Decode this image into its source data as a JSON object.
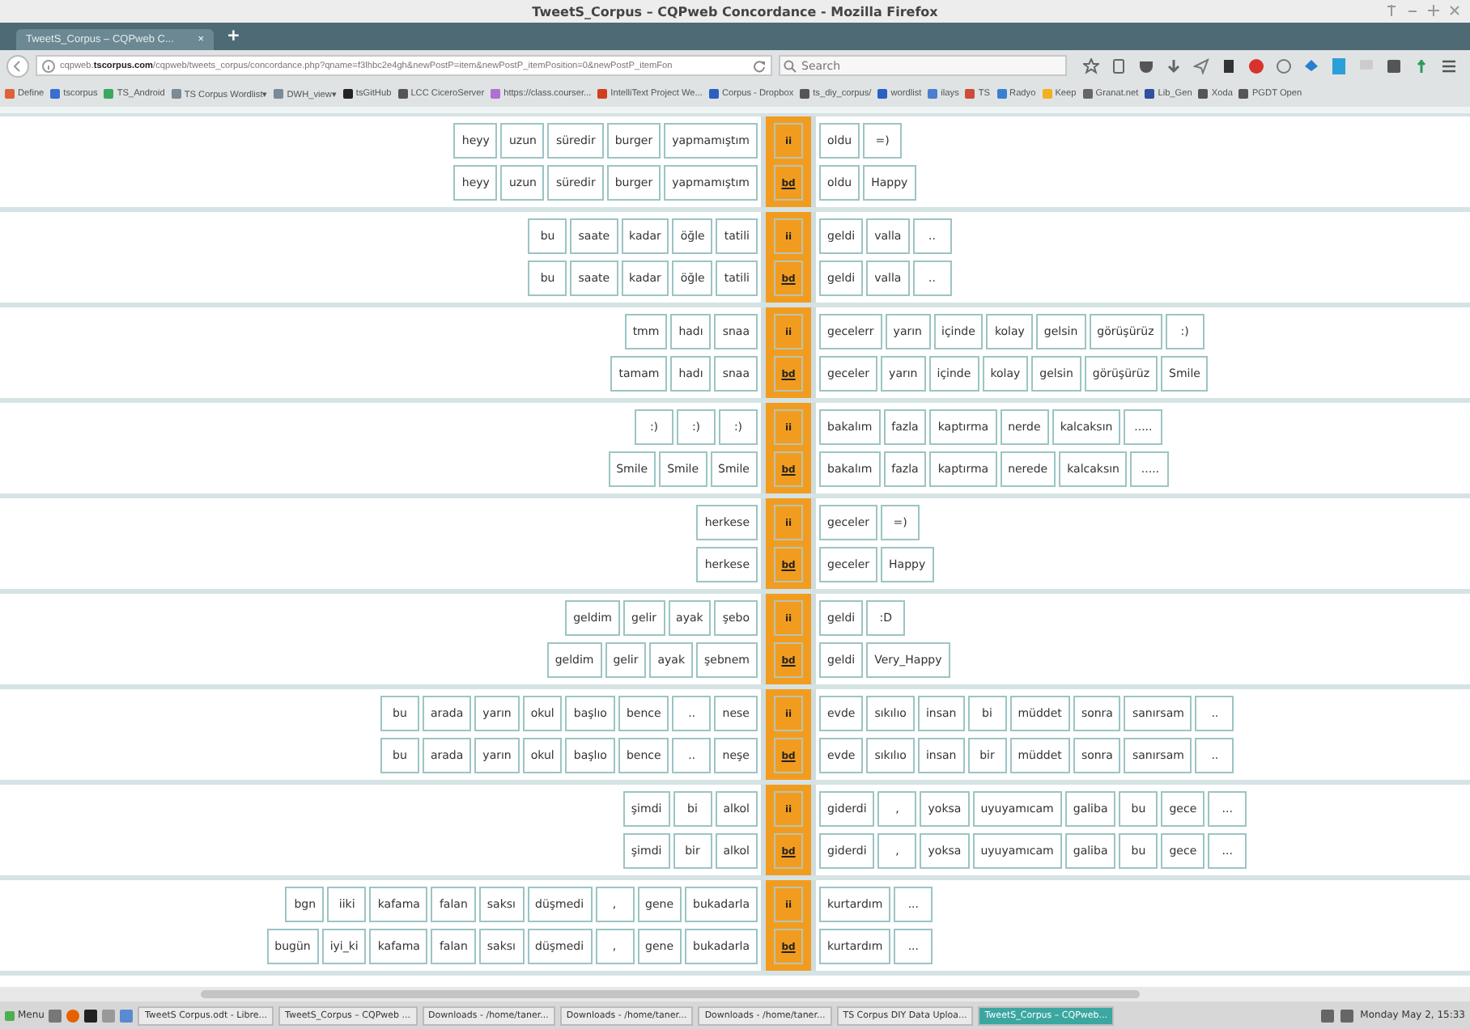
{
  "window": {
    "title": "TweetS_Corpus – CQPweb Concordance - Mozilla Firefox"
  },
  "tab": {
    "label": "TweetS_Corpus – CQPweb C...",
    "close": "×",
    "new_tab": "+"
  },
  "address": {
    "url": "cqpweb.**tscorpus.com**/cqpweb/tweets_corpus/concordance.php?qname=f3lhbc2e4gh&newPostP=item&newPostP_itemPosition=0&newPostP_itemFon",
    "search_placeholder": "Search"
  },
  "bookmarks": [
    "Define",
    "tscorpus",
    "TS_Android",
    "TS Corpus Wordlist▾",
    "DWH_view▾",
    "tsGitHub",
    "LCC CiceroServer",
    "https://class.courser...",
    "IntelliText Project We...",
    "Corpus - Dropbox",
    "ts_diy_corpus/",
    "wordlist",
    "ilays",
    "TS",
    "Radyo",
    "Keep",
    "Granat.net",
    "Lib_Gen",
    "Xoda",
    "PGDT Open"
  ],
  "concordance": [
    {
      "mark_top": "ii",
      "mark_bottom": "bd",
      "left_top": [
        "heyy",
        "uzun",
        "süredir",
        "burger",
        "yapmamıştım"
      ],
      "left_bottom": [
        "heyy",
        "uzun",
        "süredir",
        "burger",
        "yapmamıştım"
      ],
      "right_top": [
        "oldu",
        "=)"
      ],
      "right_bottom": [
        "oldu",
        "Happy"
      ]
    },
    {
      "mark_top": "ii",
      "mark_bottom": "bd",
      "left_top": [
        "bu",
        "saate",
        "kadar",
        "öğle",
        "tatili"
      ],
      "left_bottom": [
        "bu",
        "saate",
        "kadar",
        "öğle",
        "tatili"
      ],
      "right_top": [
        "geldi",
        "valla",
        ".."
      ],
      "right_bottom": [
        "geldi",
        "valla",
        ".."
      ]
    },
    {
      "mark_top": "ii",
      "mark_bottom": "bd",
      "left_top": [
        "tmm",
        "hadı",
        "snaa"
      ],
      "left_bottom": [
        "tamam",
        "hadı",
        "snaa"
      ],
      "right_top": [
        "gecelerr",
        "yarın",
        "içinde",
        "kolay",
        "gelsin",
        "görüşürüz",
        ":)"
      ],
      "right_bottom": [
        "geceler",
        "yarın",
        "içinde",
        "kolay",
        "gelsin",
        "görüşürüz",
        "Smile"
      ]
    },
    {
      "mark_top": "ii",
      "mark_bottom": "bd",
      "left_top": [
        ":)",
        ":)",
        ":)"
      ],
      "left_bottom": [
        "Smile",
        "Smile",
        "Smile"
      ],
      "right_top": [
        "bakalım",
        "fazla",
        "kaptırma",
        "nerde",
        "kalcaksın",
        "....."
      ],
      "right_bottom": [
        "bakalım",
        "fazla",
        "kaptırma",
        "nerede",
        "kalcaksın",
        "....."
      ]
    },
    {
      "mark_top": "ii",
      "mark_bottom": "bd",
      "left_top": [
        "herkese"
      ],
      "left_bottom": [
        "herkese"
      ],
      "right_top": [
        "geceler",
        "=)"
      ],
      "right_bottom": [
        "geceler",
        "Happy"
      ]
    },
    {
      "mark_top": "ii",
      "mark_bottom": "bd",
      "left_top": [
        "geldim",
        "gelir",
        "ayak",
        "şebo"
      ],
      "left_bottom": [
        "geldim",
        "gelir",
        "ayak",
        "şebnem"
      ],
      "right_top": [
        "geldi",
        ":D"
      ],
      "right_bottom": [
        "geldi",
        "Very_Happy"
      ]
    },
    {
      "mark_top": "ii",
      "mark_bottom": "bd",
      "left_top": [
        "bu",
        "arada",
        "yarın",
        "okul",
        "başlıo",
        "bence",
        "..",
        "nese"
      ],
      "left_bottom": [
        "bu",
        "arada",
        "yarın",
        "okul",
        "başlıo",
        "bence",
        "..",
        "neşe"
      ],
      "right_top": [
        "evde",
        "sıkılıo",
        "insan",
        "bi",
        "müddet",
        "sonra",
        "sanırsam",
        ".."
      ],
      "right_bottom": [
        "evde",
        "sıkılıo",
        "insan",
        "bir",
        "müddet",
        "sonra",
        "sanırsam",
        ".."
      ]
    },
    {
      "mark_top": "ii",
      "mark_bottom": "bd",
      "left_top": [
        "şimdi",
        "bi",
        "alkol"
      ],
      "left_bottom": [
        "şimdi",
        "bir",
        "alkol"
      ],
      "right_top": [
        "giderdi",
        ",",
        "yoksa",
        "uyuyamıcam",
        "galiba",
        "bu",
        "gece",
        "..."
      ],
      "right_bottom": [
        "giderdi",
        ",",
        "yoksa",
        "uyuyamıcam",
        "galiba",
        "bu",
        "gece",
        "..."
      ]
    },
    {
      "mark_top": "ii",
      "mark_bottom": "bd",
      "left_top": [
        "bgn",
        "iiki",
        "kafama",
        "falan",
        "saksı",
        "düşmedi",
        ",",
        "gene",
        "bukadarla"
      ],
      "left_bottom": [
        "bugün",
        "iyi_ki",
        "kafama",
        "falan",
        "saksı",
        "düşmedi",
        ",",
        "gene",
        "bukadarla"
      ],
      "right_top": [
        "kurtardım",
        "..."
      ],
      "right_bottom": [
        "kurtardım",
        "..."
      ]
    }
  ],
  "taskbar": {
    "menu": "Menu",
    "tasks": [
      {
        "label": "TweetS Corpus.odt - Libre...",
        "selected": false
      },
      {
        "label": "TweetS_Corpus – CQPweb ...",
        "selected": false
      },
      {
        "label": "Downloads - /home/taner...",
        "selected": false
      },
      {
        "label": "Downloads - /home/taner...",
        "selected": false
      },
      {
        "label": "Downloads - /home/taner...",
        "selected": false
      },
      {
        "label": "TS Corpus DIY Data Uploa...",
        "selected": false
      },
      {
        "label": "TweetS_Corpus – CQPweb...",
        "selected": true
      }
    ],
    "clock": "Monday May 2, 15:33"
  }
}
